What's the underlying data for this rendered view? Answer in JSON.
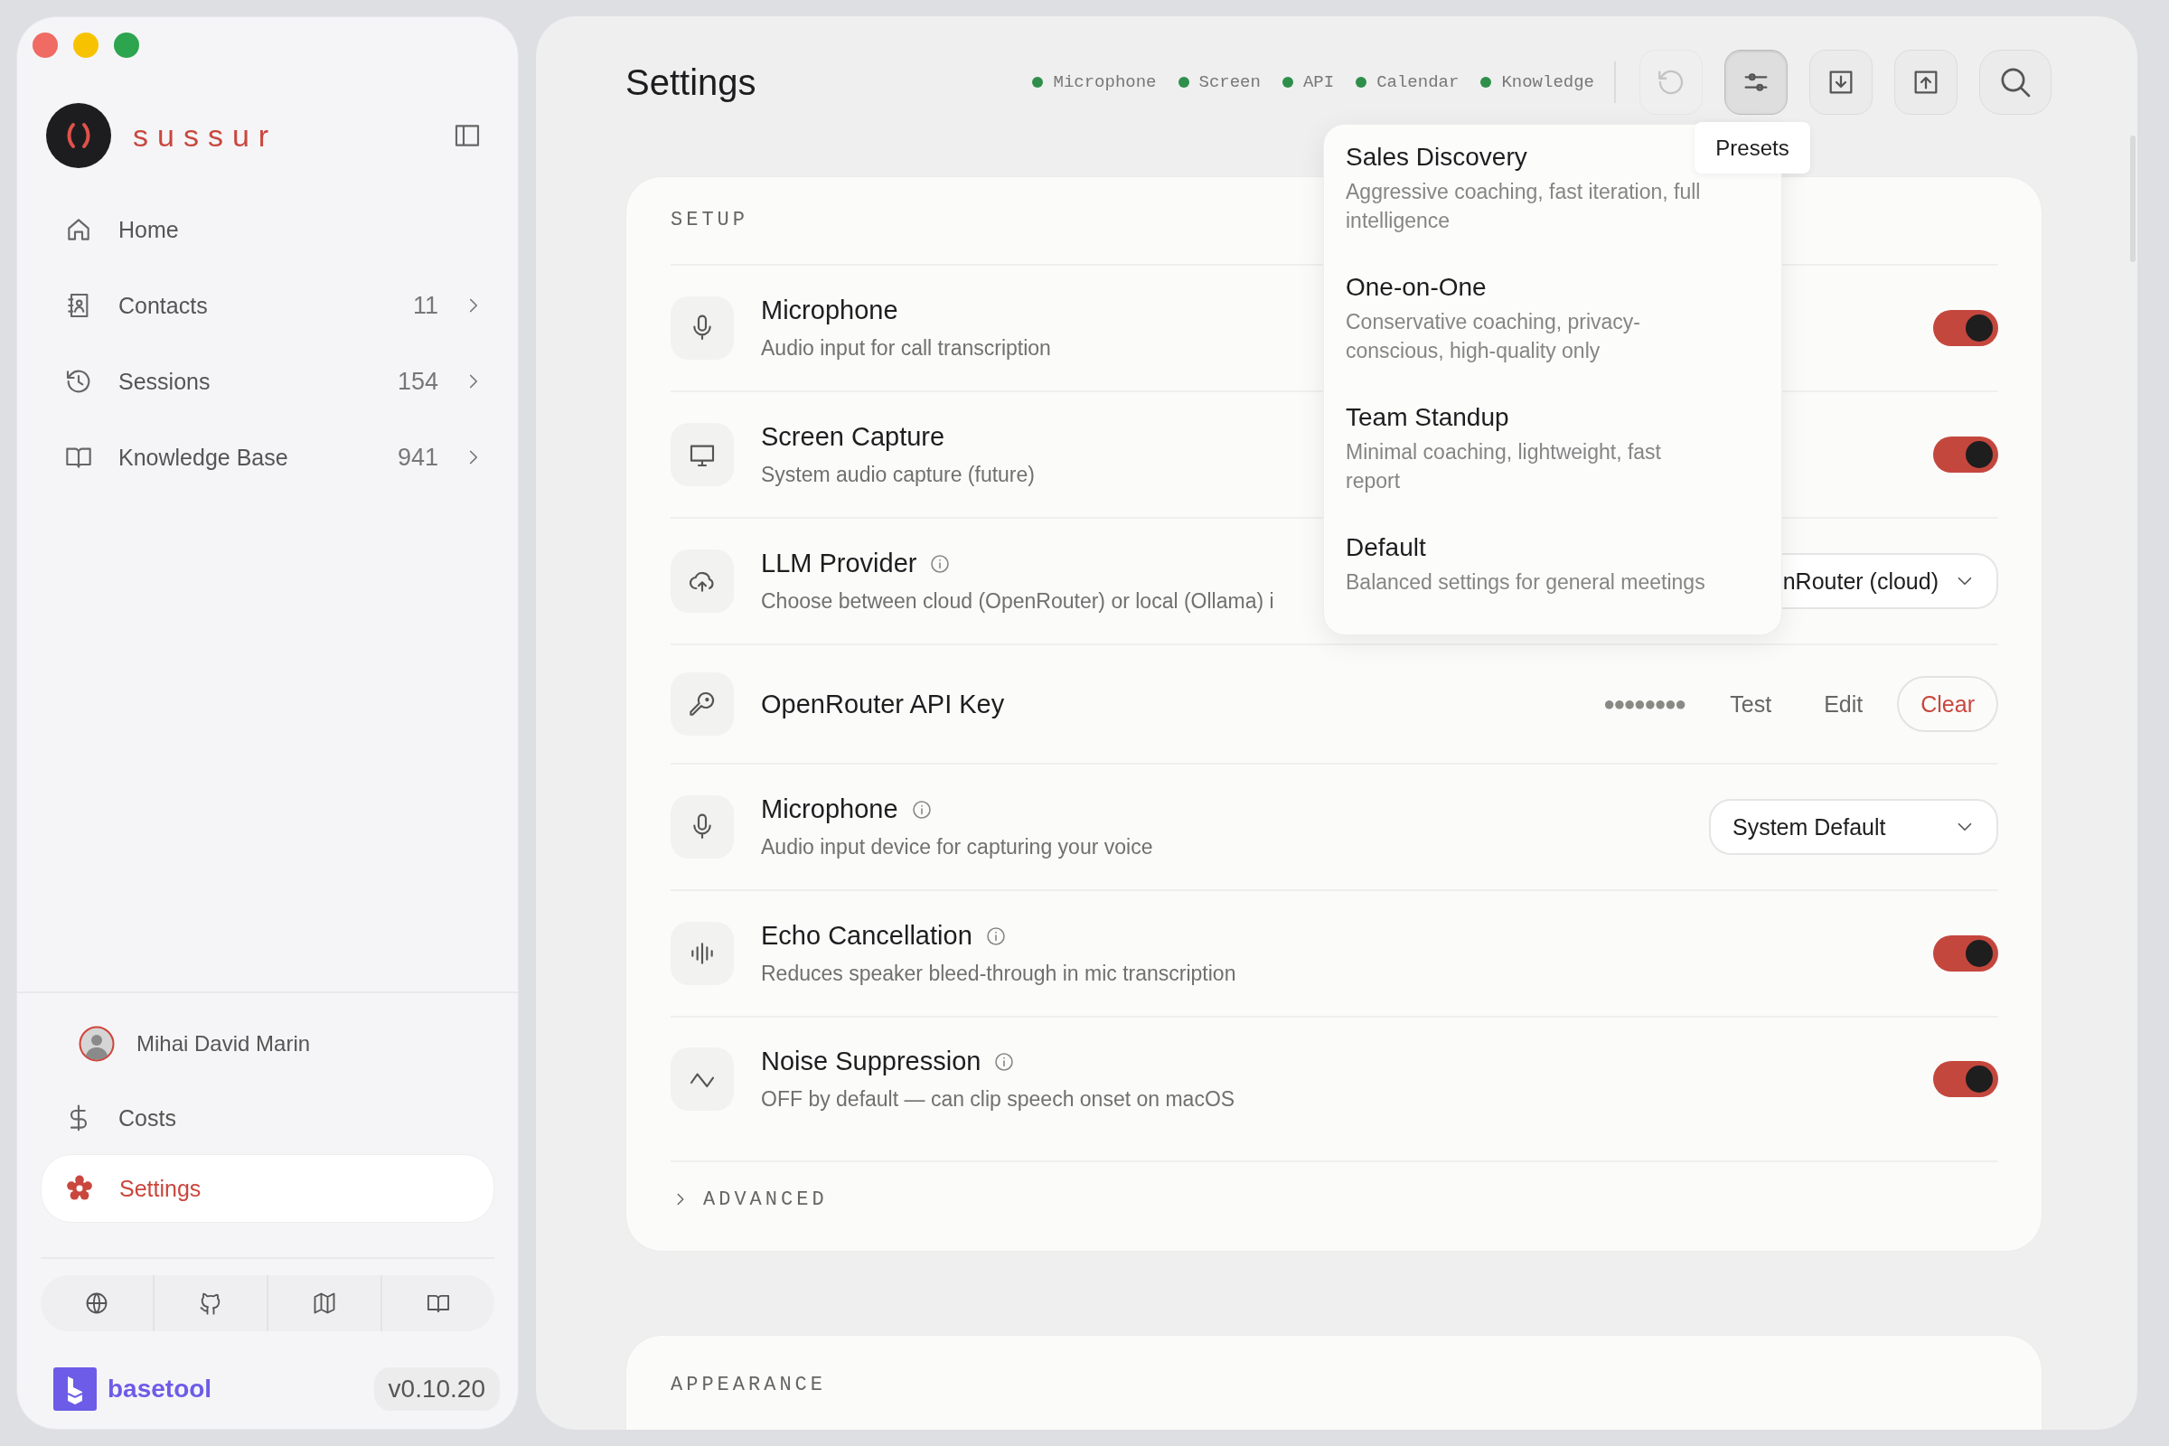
{
  "sidebar": {
    "brand": "sussur",
    "nav": [
      {
        "label": "Home",
        "selected": false
      },
      {
        "label": "Contacts",
        "count": "11",
        "selected": false
      },
      {
        "label": "Sessions",
        "count": "154",
        "selected": false
      },
      {
        "label": "Knowledge Base",
        "count": "941",
        "selected": false
      }
    ],
    "user": "Mihai David Marin",
    "bottom_nav": [
      {
        "label": "Costs",
        "selected": false
      },
      {
        "label": "Settings",
        "selected": true
      }
    ],
    "footer": {
      "brand": "basetool",
      "version": "v0.10.20"
    }
  },
  "header": {
    "title": "Settings",
    "status": [
      {
        "label": "Microphone",
        "on": true
      },
      {
        "label": "Screen",
        "on": true
      },
      {
        "label": "API",
        "on": true
      },
      {
        "label": "Calendar",
        "on": true
      },
      {
        "label": "Knowledge",
        "on": true
      }
    ],
    "toolbar": [
      {
        "disabled": true,
        "active": false
      },
      {
        "disabled": false,
        "active": true
      },
      {
        "disabled": false,
        "active": false
      },
      {
        "disabled": false,
        "active": false
      },
      {
        "disabled": false,
        "active": false
      }
    ],
    "tooltip": "Presets"
  },
  "presets_menu": [
    {
      "title": "Sales Discovery",
      "description": "Aggressive coaching, fast iteration, full intelligence"
    },
    {
      "title": "One-on-One",
      "description": "Conservative coaching, privacy-conscious, high-quality only"
    },
    {
      "title": "Team Standup",
      "description": "Minimal coaching, lightweight, fast report"
    },
    {
      "title": "Default",
      "description": "Balanced settings for general meetings"
    }
  ],
  "setup": {
    "heading": "SETUP",
    "rows": [
      {
        "kind": "toggle",
        "title": "Microphone",
        "info": false,
        "subtitle": "Audio input for call transcription",
        "on": true
      },
      {
        "kind": "toggle",
        "title": "Screen Capture",
        "info": false,
        "subtitle": "System audio capture (future)",
        "on": true
      },
      {
        "kind": "select",
        "title": "LLM Provider",
        "info": true,
        "subtitle": "Choose between cloud (OpenRouter) or local (Ollama) i",
        "value": "nRouter (cloud)"
      },
      {
        "kind": "api_key",
        "title": "OpenRouter API Key",
        "info": false,
        "masked": "●●●●●●●●",
        "actions": [
          {
            "label": "Test",
            "kind": "plain"
          },
          {
            "label": "Edit",
            "kind": "plain"
          },
          {
            "label": "Clear",
            "kind": "danger"
          }
        ]
      },
      {
        "kind": "select",
        "title": "Microphone",
        "info": true,
        "subtitle": "Audio input device for capturing your voice",
        "value": "System Default"
      },
      {
        "kind": "toggle",
        "title": "Echo Cancellation",
        "info": true,
        "subtitle": "Reduces speaker bleed-through in mic transcription",
        "on": true
      },
      {
        "kind": "toggle",
        "title": "Noise Suppression",
        "info": true,
        "subtitle": "OFF by default — can clip speech onset on macOS",
        "on": true
      }
    ],
    "advanced": {
      "label": "ADVANCED",
      "expanded": false
    }
  },
  "appearance": {
    "heading": "APPEARANCE"
  }
}
